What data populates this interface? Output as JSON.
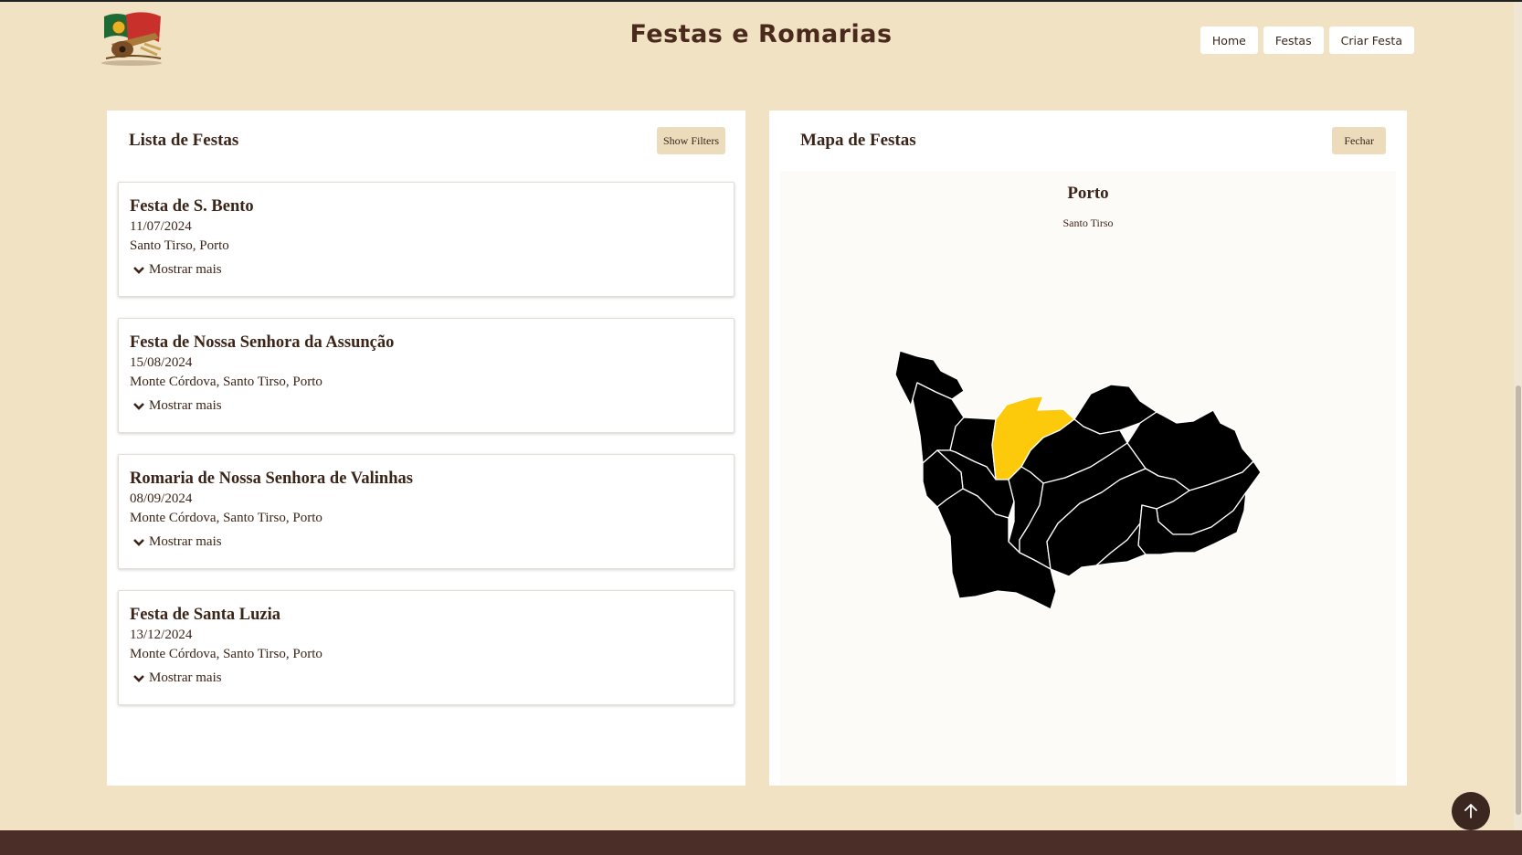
{
  "header": {
    "title": "Festas e Romarias",
    "nav": [
      "Home",
      "Festas",
      "Criar Festa"
    ]
  },
  "list": {
    "title": "Lista de Festas",
    "filter_label": "Show Filters",
    "items": [
      {
        "name": "Festa de S. Bento",
        "date": "11/07/2024",
        "location": "Santo Tirso, Porto",
        "more": "Mostrar mais"
      },
      {
        "name": "Festa de Nossa Senhora da Assunção",
        "date": "15/08/2024",
        "location": "Monte Córdova, Santo Tirso, Porto",
        "more": "Mostrar mais"
      },
      {
        "name": "Romaria de Nossa Senhora de Valinhas",
        "date": "08/09/2024",
        "location": "Monte Córdova, Santo Tirso, Porto",
        "more": "Mostrar mais"
      },
      {
        "name": "Festa de Santa Luzia",
        "date": "13/12/2024",
        "location": "Monte Córdova, Santo Tirso, Porto",
        "more": "Mostrar mais"
      }
    ]
  },
  "map": {
    "title": "Mapa de Festas",
    "close_label": "Fechar",
    "region": "Porto",
    "selected": "Santo Tirso",
    "colors": {
      "region_fill": "#000000",
      "highlight": "#fdc90b",
      "border": "#ffffff"
    }
  },
  "icons": [
    "logo-icon",
    "chevron-down-icon",
    "arrow-up-icon"
  ],
  "colors": {
    "background": "#f2e2c4",
    "accent_button": "#ecdcbc",
    "footer": "#4b2e27",
    "text": "#3b2418"
  }
}
